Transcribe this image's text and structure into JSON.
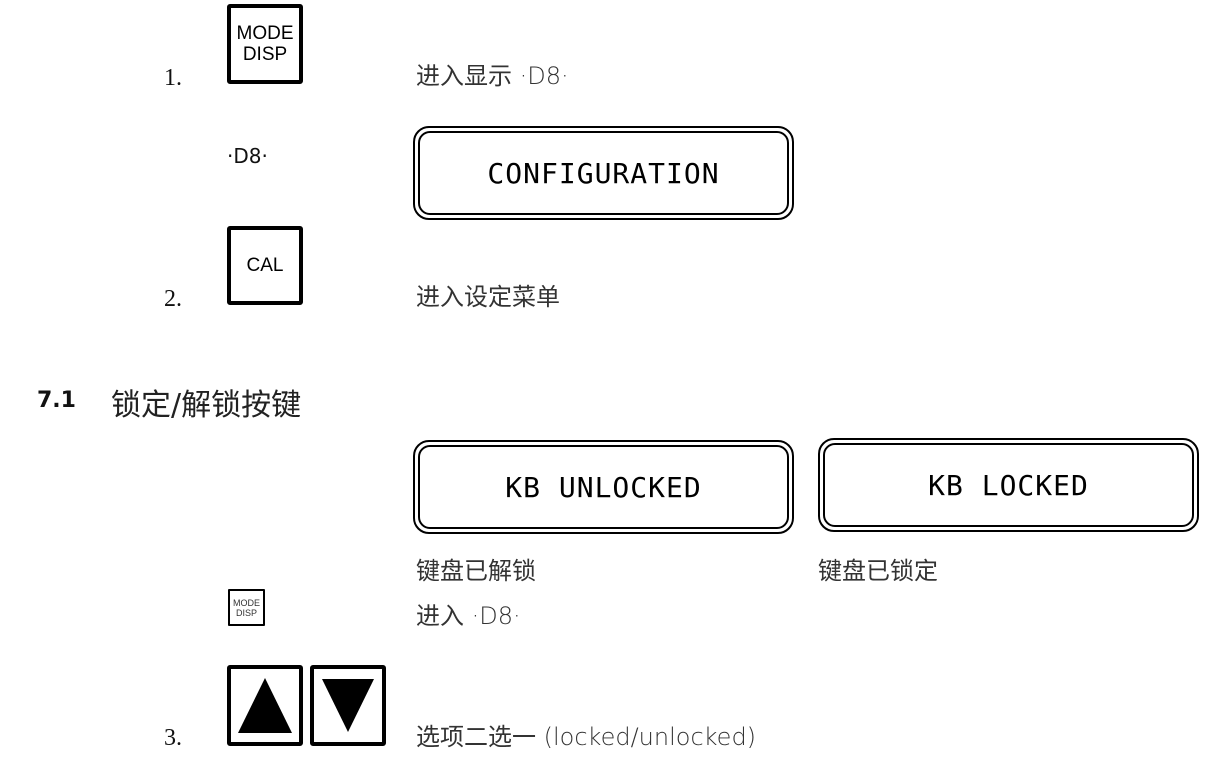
{
  "steps": [
    {
      "number": "1.",
      "key": {
        "lines": [
          "MODE",
          "DISP"
        ]
      },
      "description": "进入显示 ·D8·"
    },
    {
      "number": "2.",
      "key": {
        "lines": [
          "CAL"
        ]
      },
      "description": "进入设定菜单"
    },
    {
      "number": "3.",
      "keys": [
        "arrow-up",
        "arrow-down"
      ],
      "description": "选项二选一 (locked/unlocked)"
    }
  ],
  "d8_label": "·D8·",
  "displays": {
    "configuration": "CONFIGURATION",
    "kb_unlocked": "KB UNLOCKED",
    "kb_locked": "KB LOCKED"
  },
  "section": {
    "number": "7.1",
    "title": "锁定/解锁按键"
  },
  "captions": {
    "unlocked": "键盘已解锁",
    "locked": "键盘已锁定"
  },
  "small_key": {
    "lines": [
      "MODE",
      "DISP"
    ]
  },
  "enter_d8": "进入 ·D8·"
}
